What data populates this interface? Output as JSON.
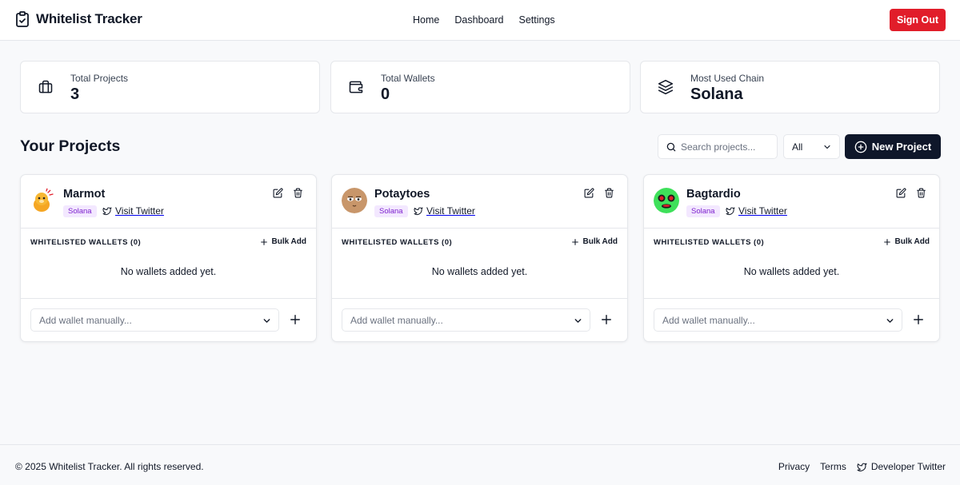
{
  "header": {
    "brand_title": "Whitelist Tracker",
    "nav": [
      "Home",
      "Dashboard",
      "Settings"
    ],
    "sign_out_label": "Sign Out",
    "sign_out_color": "#e11d2a"
  },
  "stats": [
    {
      "label": "Total Projects",
      "value": "3",
      "icon": "briefcase-icon"
    },
    {
      "label": "Total Wallets",
      "value": "0",
      "icon": "wallet-icon"
    },
    {
      "label": "Most Used Chain",
      "value": "Solana",
      "icon": "layers-icon"
    }
  ],
  "projects_section": {
    "title": "Your Projects",
    "search_placeholder": "Search projects...",
    "filter_value": "All",
    "new_project_label": "New Project"
  },
  "projects": [
    {
      "name": "Marmot",
      "chain": "Solana",
      "twitter_label": "Visit Twitter",
      "wallets_header": "WHITELISTED WALLETS (0)",
      "bulk_add_label": "Bulk Add",
      "empty_text": "No wallets added yet.",
      "wallet_placeholder": "Add wallet manually..."
    },
    {
      "name": "Potaytoes",
      "chain": "Solana",
      "twitter_label": "Visit Twitter",
      "wallets_header": "WHITELISTED WALLETS (0)",
      "bulk_add_label": "Bulk Add",
      "empty_text": "No wallets added yet.",
      "wallet_placeholder": "Add wallet manually..."
    },
    {
      "name": "Bagtardio",
      "chain": "Solana",
      "twitter_label": "Visit Twitter",
      "wallets_header": "WHITELISTED WALLETS (0)",
      "bulk_add_label": "Bulk Add",
      "empty_text": "No wallets added yet.",
      "wallet_placeholder": "Add wallet manually..."
    }
  ],
  "footer": {
    "copyright": "© 2025 Whitelist Tracker. All rights reserved.",
    "privacy": "Privacy",
    "terms": "Terms",
    "developer_twitter": "Developer Twitter"
  }
}
